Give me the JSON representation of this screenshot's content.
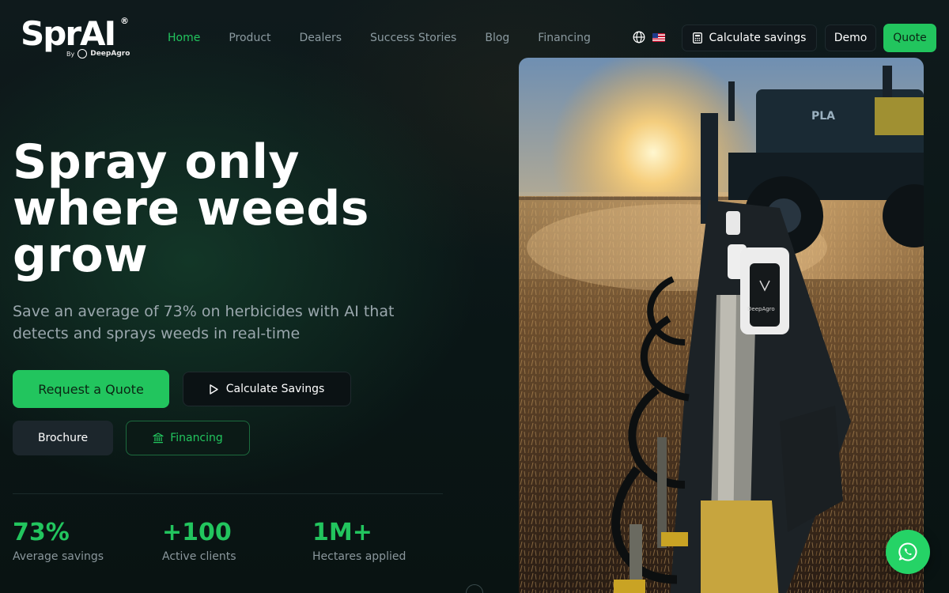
{
  "brand": {
    "name": "SprAI",
    "registered": "®",
    "by_text": "By",
    "company": "DeepAgro"
  },
  "nav": {
    "items": [
      {
        "label": "Home",
        "active": true
      },
      {
        "label": "Product",
        "active": false
      },
      {
        "label": "Dealers",
        "active": false
      },
      {
        "label": "Success Stories",
        "active": false
      },
      {
        "label": "Blog",
        "active": false
      },
      {
        "label": "Financing",
        "active": false
      }
    ],
    "language_icon": "globe-icon",
    "flag_icon": "us-flag-icon"
  },
  "header_actions": {
    "calculate_label": "Calculate savings",
    "calculate_icon": "calculator-icon",
    "demo_label": "Demo",
    "quote_label": "Quote"
  },
  "hero": {
    "title_lines": [
      "Spray only",
      "where weeds",
      "grow"
    ],
    "subtitle": "Save an average of 73% on herbicides with AI that detects and sprays weeds in real-time",
    "request_quote_label": "Request a Quote",
    "calculate_savings_label": "Calculate Savings",
    "calculate_savings_icon": "play-icon",
    "brochure_label": "Brochure",
    "financing_label": "Financing",
    "financing_icon": "bank-icon"
  },
  "stats": [
    {
      "value": "73%",
      "label": "Average savings"
    },
    {
      "value": "+100",
      "label": "Active clients"
    },
    {
      "value": "1M+",
      "label": "Hectares applied"
    }
  ],
  "hero_image": {
    "sprayer_brand": "PLA",
    "nozzle_brand": "DeepAgro"
  },
  "colors": {
    "accent": "#22c55e",
    "background": "#0b1414",
    "muted_text": "#8b9aa0",
    "whatsapp": "#25d366"
  },
  "floating": {
    "whatsapp_icon": "whatsapp-icon"
  }
}
